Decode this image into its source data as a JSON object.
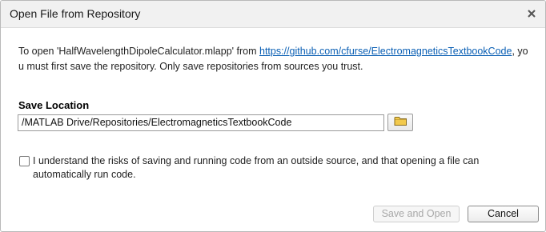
{
  "dialog": {
    "title": "Open File from Repository",
    "close_icon": "close-icon"
  },
  "message": {
    "prefix": "To open 'HalfWavelengthDipoleCalculator.mlapp' from ",
    "link": "https://github.com/cfurse/ElectromagneticsTextbookCode",
    "suffix": ", you must first save the repository. Only save repositories from sources you trust."
  },
  "save_location": {
    "label": "Save Location",
    "path": "/MATLAB Drive/Repositories/ElectromagneticsTextbookCode",
    "browse_icon": "folder-icon"
  },
  "acknowledge": {
    "checked": false,
    "label": "I understand the risks of saving and running code from an outside source, and that opening a file can automatically run code."
  },
  "buttons": {
    "save_and_open": "Save and Open",
    "cancel": "Cancel"
  },
  "colors": {
    "link": "#0a5fb4",
    "titlebar": "#f1f1f1",
    "folder": "#f2c94c"
  }
}
